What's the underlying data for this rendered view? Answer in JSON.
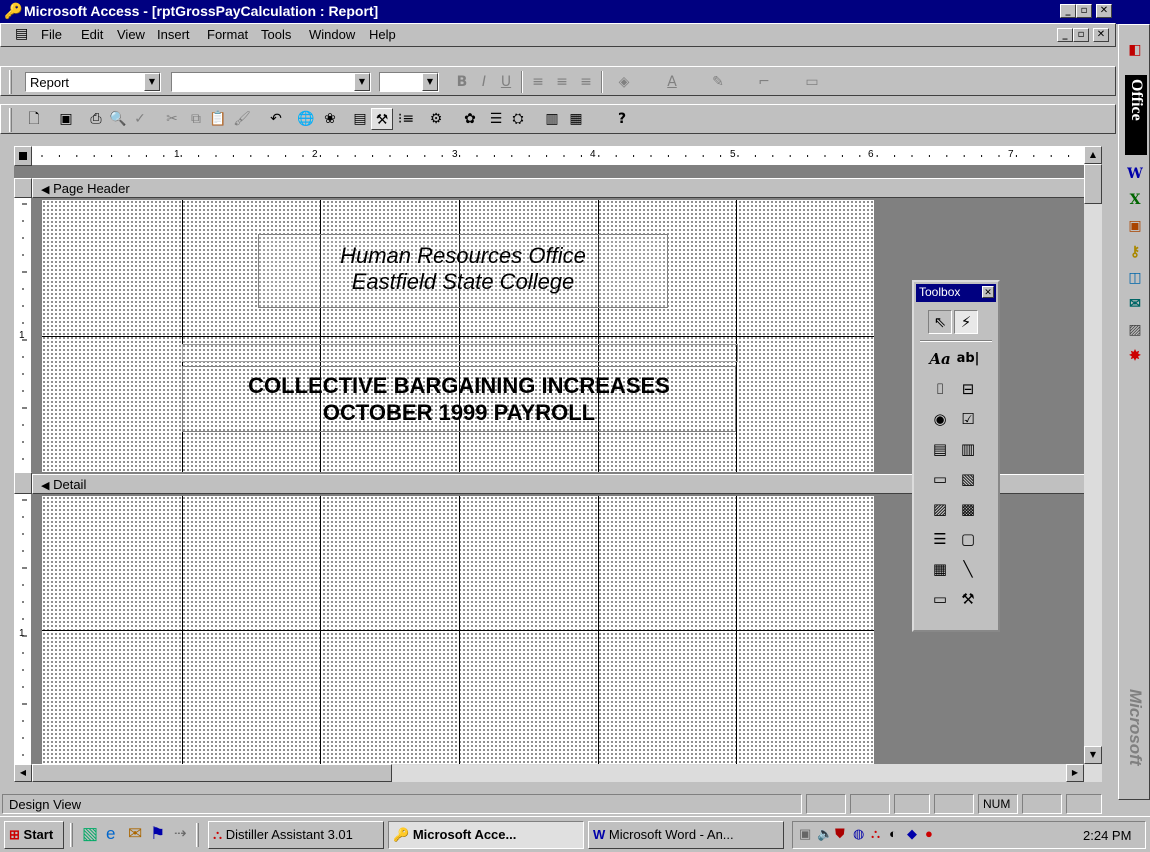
{
  "window": {
    "title": "Microsoft Access - [rptGrossPayCalculation : Report]"
  },
  "menu": [
    "File",
    "Edit",
    "View",
    "Insert",
    "Format",
    "Tools",
    "Window",
    "Help"
  ],
  "toolbar": {
    "object_combo": "Report"
  },
  "ruler": {
    "marks": [
      "1",
      "2",
      "3",
      "4",
      "5",
      "6",
      "7"
    ]
  },
  "sections": {
    "page_header": "Page Header",
    "detail": "Detail"
  },
  "report": {
    "header_line1": "Human Resources Office",
    "header_line2": "Eastfield State College",
    "title_line1": "COLLECTIVE BARGAINING INCREASES",
    "title_line2": "OCTOBER 1999 PAYROLL"
  },
  "vruler": {
    "marks": [
      "1",
      "1"
    ]
  },
  "toolbox": {
    "title": "Toolbox",
    "label_tool": "Aa",
    "textbox_tool": "ab|"
  },
  "office_bar": {
    "label": "Office",
    "brand": "Microsoft"
  },
  "status": {
    "mode": "Design View",
    "num": "NUM"
  },
  "taskbar": {
    "start": "Start",
    "tasks": [
      "Distiller Assistant 3.01",
      "Microsoft Acce...",
      "Microsoft Word - An..."
    ],
    "clock": "2:24 PM"
  }
}
